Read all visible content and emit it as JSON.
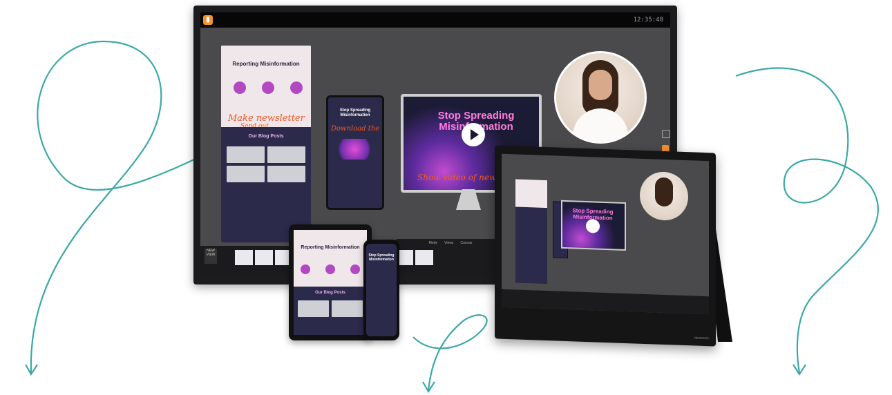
{
  "colors": {
    "accent_teal": "#3aa9a6",
    "handwriting_orange": "#f15a24",
    "brand_pink": "#ff7de0",
    "app_orange": "#f2902b"
  },
  "display": {
    "clock": "12:35:48",
    "doc": {
      "title": "Reporting Misinformation",
      "handwriting_1": "Make newsletter",
      "handwriting_2": "Send out",
      "blog_heading": "Our Blog Posts"
    },
    "phone_doc": {
      "title": "Stop Spreading Misinformation",
      "handwriting": "Download the"
    },
    "monitor": {
      "title": "Stop Spreading Misinformation",
      "handwriting": "Show video of news"
    },
    "dock": {
      "new_label": "NEW VIEW",
      "tabs": [
        "Mode",
        "Views",
        "Canvas"
      ]
    }
  },
  "tablet": {
    "title": "Reporting Misinformation",
    "blog_heading": "Our Blog Posts"
  },
  "phone": {
    "title": "Stop Spreading Misinformation"
  },
  "portable": {
    "title": "Stop Spreading Misinformation",
    "brand": "viewsonic"
  }
}
